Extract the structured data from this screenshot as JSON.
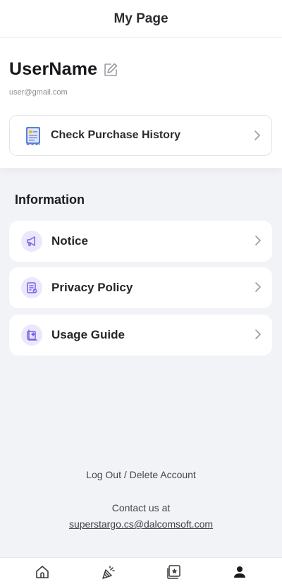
{
  "header": {
    "title": "My Page"
  },
  "profile": {
    "username": "UserName",
    "email": "user@gmail.com",
    "purchase_history_label": "Check Purchase History"
  },
  "information": {
    "title": "Information",
    "items": [
      {
        "label": "Notice",
        "icon": "megaphone-icon"
      },
      {
        "label": "Privacy Policy",
        "icon": "document-check-icon"
      },
      {
        "label": "Usage Guide",
        "icon": "guide-sparkle-icon"
      }
    ]
  },
  "footer": {
    "logout_label": "Log Out / Delete Account",
    "contact_label": "Contact us at",
    "contact_email": "superstargo.cs@dalcomsoft.com"
  },
  "tabbar": {
    "tabs": [
      {
        "icon": "home-icon"
      },
      {
        "icon": "party-popper-icon"
      },
      {
        "icon": "star-photo-icon"
      },
      {
        "icon": "person-icon",
        "active": true
      }
    ]
  },
  "colors": {
    "accent": "#7b5cf0",
    "accent_bg": "#ece8fb",
    "page_bg": "#f2f3f7"
  }
}
